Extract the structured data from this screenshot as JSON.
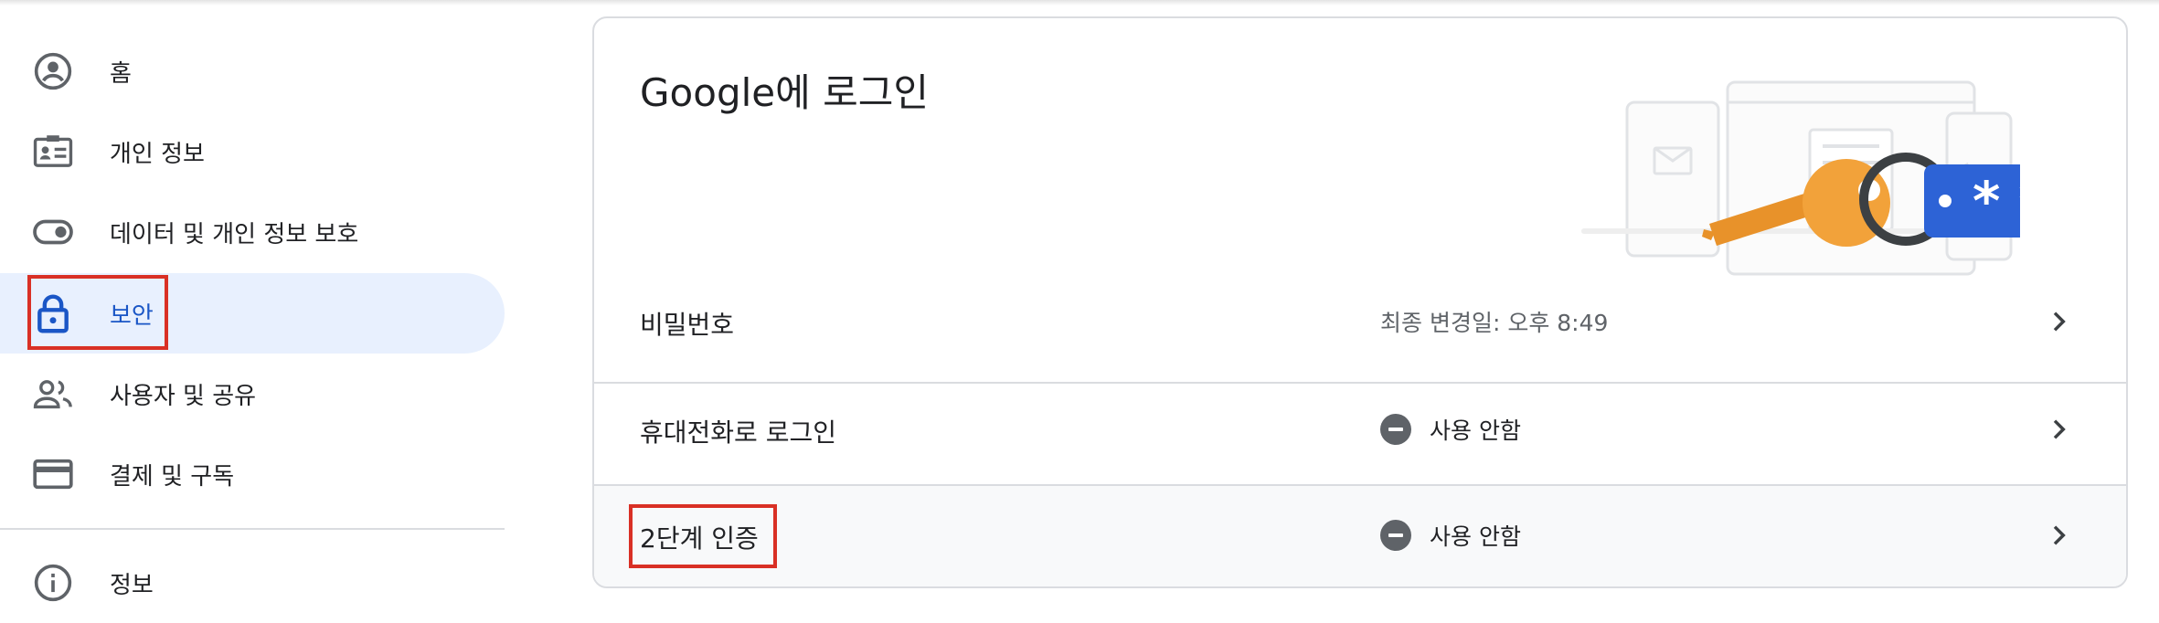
{
  "sidebar": {
    "items": [
      {
        "label": "홈",
        "icon": "account-circle-icon"
      },
      {
        "label": "개인 정보",
        "icon": "id-card-icon"
      },
      {
        "label": "데이터 및 개인 정보 보호",
        "icon": "toggle-icon"
      },
      {
        "label": "보안",
        "icon": "lock-icon",
        "active": true
      },
      {
        "label": "사용자 및 공유",
        "icon": "people-icon"
      },
      {
        "label": "결제 및 구독",
        "icon": "credit-card-icon"
      },
      {
        "label": "정보",
        "icon": "info-icon"
      }
    ]
  },
  "card": {
    "title": "Google에 로그인",
    "rows": [
      {
        "label": "비밀번호",
        "status": "최종 변경일: 오후 8:49"
      },
      {
        "label": "휴대전화로 로그인",
        "status": "사용 안함",
        "status_icon": "minus-circle-icon"
      },
      {
        "label": "2단계 인증",
        "status": "사용 안함",
        "status_icon": "minus-circle-icon"
      }
    ]
  },
  "colors": {
    "accent": "#1a56c6",
    "active_bg": "#e8f0fe",
    "highlight": "#d93025",
    "key": "#f2a23a",
    "tag": "#2d63d6"
  }
}
